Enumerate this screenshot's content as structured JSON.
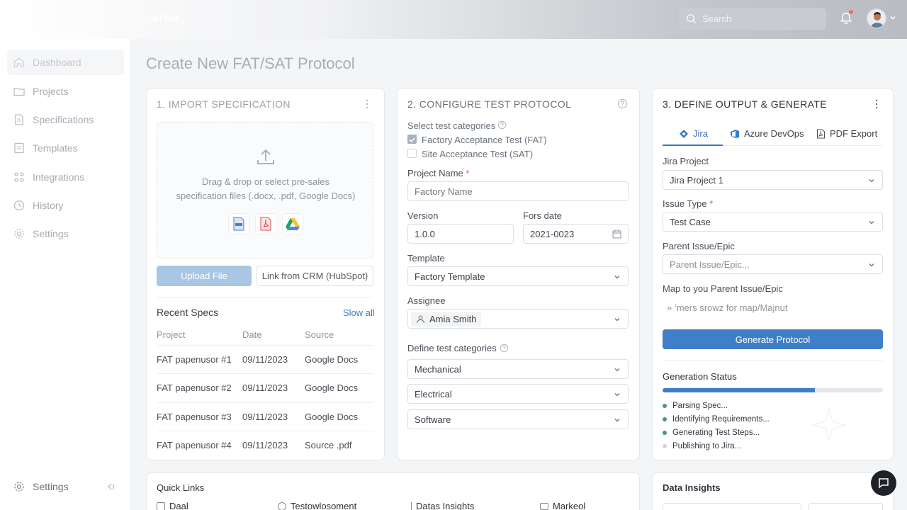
{
  "header": {
    "brand": "ATOR",
    "search_placeholder": "Search"
  },
  "sidebar": {
    "items": [
      {
        "label": "Dashboard",
        "icon": "home-icon"
      },
      {
        "label": "Projects",
        "icon": "folder-icon"
      },
      {
        "label": "Specifications",
        "icon": "document-icon"
      },
      {
        "label": "Templates",
        "icon": "template-icon"
      },
      {
        "label": "Integrations",
        "icon": "integrations-icon"
      },
      {
        "label": "History",
        "icon": "history-icon"
      },
      {
        "label": "Settings",
        "icon": "gear-icon"
      }
    ],
    "bottom_settings": "Settings"
  },
  "page": {
    "title": "Create New FAT/SAT Protocol"
  },
  "import": {
    "title": "1. IMPORT SPECIFICATION",
    "drop_line1": "Drag & drop or select pre-sales",
    "drop_line2": "specification files (.docx, .pdf, Google Docs)",
    "upload_label": "Upload File",
    "crm_label": "Link from CRM (HubSpot)",
    "recent_title": "Recent Specs",
    "show_all": "Slow all",
    "columns": [
      "Project",
      "Date",
      "Source"
    ],
    "rows": [
      {
        "project": "FAT papenusor #1",
        "date": "09/11/2023",
        "source": "Google Docs"
      },
      {
        "project": "FAT papenusor #2",
        "date": "09/11/2023",
        "source": "Google Docs"
      },
      {
        "project": "FAT papenusor #3",
        "date": "09/11/2023",
        "source": "Google Docs"
      },
      {
        "project": "FAT papenusor #4",
        "date": "09/11/2023",
        "source": "Source .pdf"
      }
    ]
  },
  "configure": {
    "title": "2. CONFIGURE TEST PROTOCOL",
    "select_categories_label": "Select test categories",
    "fat_label": "Factory Acceptance Test (FAT)",
    "sat_label": "Site Acceptance Test (SAT)",
    "fat_checked": true,
    "sat_checked": false,
    "project_name_label": "Project Name",
    "required_mark": "*",
    "project_name_placeholder": "Factory Name",
    "version_label": "Version",
    "version_value": "1.0.0",
    "date_label": "Fors date",
    "date_value": "2021-0023",
    "template_label": "Template",
    "template_value": "Factory Template",
    "assignee_label": "Assignee",
    "assignee_value": "Amia Smith",
    "define_categories_label": "Define test categories",
    "categories": [
      "Mechanical",
      "Electrical",
      "Software"
    ]
  },
  "output": {
    "title": "3. DEFINE OUTPUT & GENERATE",
    "tabs": [
      {
        "label": "Jira",
        "icon": "jira-icon"
      },
      {
        "label": "Azure DevOps",
        "icon": "azure-devops-icon"
      },
      {
        "label": "PDF Export",
        "icon": "pdf-icon"
      }
    ],
    "jira_project_label": "Jira Project",
    "jira_project_value": "Jira Project 1",
    "issue_type_label": "Issue Type",
    "issue_type_value": "Test Case",
    "parent_label": "Parent Issue/Epic",
    "parent_placeholder": "Parent Issue/Epic...",
    "map_label": "Map to уou Parent Issue/Epic",
    "map_hint": "» ’mers srowz for map/Majnut",
    "generate_label": "Generate Protocol",
    "status_title": "Generation Status",
    "progress": 0.69,
    "status_items": [
      {
        "label": "Parsing Spec...",
        "done": true
      },
      {
        "label": "Identifying Requirements...",
        "done": true
      },
      {
        "label": "Generating Test Steps...",
        "done": true
      },
      {
        "label": "Publishing to Jira...",
        "done": false
      }
    ]
  },
  "quick_links": {
    "title": "Quick Links",
    "items": [
      "Daal",
      "Testowlosoment",
      "Datas Insights",
      "Markeol"
    ]
  },
  "insights": {
    "title": "Data Insights"
  },
  "colors": {
    "accent": "#3f7fc9",
    "success": "#3f9e6a",
    "danger": "#e0575b"
  }
}
